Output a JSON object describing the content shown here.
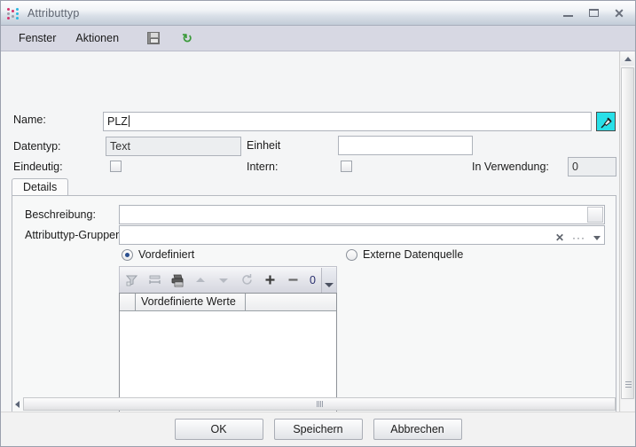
{
  "window": {
    "title": "Attributtyp",
    "icon": "attribute-type-dots-icon",
    "controls": {
      "minimize": "–",
      "maximize": "□",
      "close": "✕"
    }
  },
  "menubar": {
    "items": [
      {
        "label": "Fenster"
      },
      {
        "label": "Aktionen"
      }
    ],
    "icons": [
      {
        "name": "save-icon"
      },
      {
        "name": "refresh-icon"
      }
    ]
  },
  "form": {
    "name_label": "Name:",
    "name_value": "PLZ",
    "name_placeholder": "",
    "pick_button": "pin-picker-icon",
    "datatype_label": "Datentyp:",
    "datatype_value": "Text",
    "unit_label": "Einheit",
    "unit_value": "",
    "unique_label": "Eindeutig:",
    "unique_checked": false,
    "internal_label": "Intern:",
    "internal_checked": false,
    "inuse_label": "In Verwendung:",
    "inuse_value": "0"
  },
  "tabs": [
    {
      "label": "Details",
      "active": true
    }
  ],
  "details": {
    "description_label": "Beschreibung:",
    "description_value": "",
    "groups_label": "Attributtyp-Gruppen:",
    "groups_value": "",
    "groups_buttons": {
      "clear": "✕",
      "browse": "···",
      "dropdown": "▾"
    },
    "source_options": [
      {
        "label": "Vordefiniert",
        "selected": true
      },
      {
        "label": "Externe Datenquelle",
        "selected": false
      }
    ]
  },
  "grid_toolbar": {
    "icons": [
      {
        "name": "filter-icon",
        "enabled": false
      },
      {
        "name": "fit-columns-icon",
        "enabled": false
      },
      {
        "name": "print-icon",
        "enabled": true
      },
      {
        "name": "move-up-icon",
        "enabled": false
      },
      {
        "name": "move-down-icon",
        "enabled": false
      },
      {
        "name": "refresh-icon",
        "enabled": false
      },
      {
        "name": "add-icon",
        "enabled": true
      },
      {
        "name": "remove-icon",
        "enabled": true
      }
    ],
    "count": "0",
    "overflow": "▾"
  },
  "grid": {
    "columns": [
      {
        "label": ""
      },
      {
        "label": "Vordefinierte Werte"
      },
      {
        "label": ""
      }
    ],
    "rows": []
  },
  "footer": {
    "buttons": [
      {
        "label": "OK",
        "name": "ok-button"
      },
      {
        "label": "Speichern",
        "name": "save-button"
      },
      {
        "label": "Abbrechen",
        "name": "cancel-button"
      }
    ]
  },
  "colors": {
    "accent": "#29e0e8",
    "radio_dot": "#2a4f8f",
    "titlebar": "#d9e0e8",
    "menubar": "#d7d8e3"
  }
}
